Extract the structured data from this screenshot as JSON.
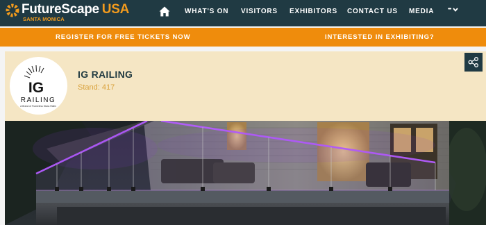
{
  "brand": {
    "name": "FutureScape",
    "region": "USA",
    "location": "SANTA MONICA"
  },
  "nav": {
    "items": [
      "WHAT'S ON",
      "VISITORS",
      "EXHIBITORS",
      "CONTACT US",
      "MEDIA"
    ],
    "more_label": "•••",
    "icons": {
      "home": "home-icon",
      "more": "chevron-down-icon"
    }
  },
  "cta": {
    "register": "REGISTER FOR FREE TICKETS NOW",
    "exhibit": "INTERESTED IN EXHIBITING?"
  },
  "exhibitor": {
    "name": "IG RAILING",
    "stand": "Stand: 417",
    "logo": {
      "top": "IG",
      "bottom": "RAILING",
      "tagline": "A Brand of Frameless Glass Railin"
    },
    "share_icon": "share-icon"
  },
  "colors": {
    "navy": "#203a43",
    "orange": "#ef8c0c",
    "cream": "#f5e6c4",
    "accent_gold": "#d9a23d"
  }
}
